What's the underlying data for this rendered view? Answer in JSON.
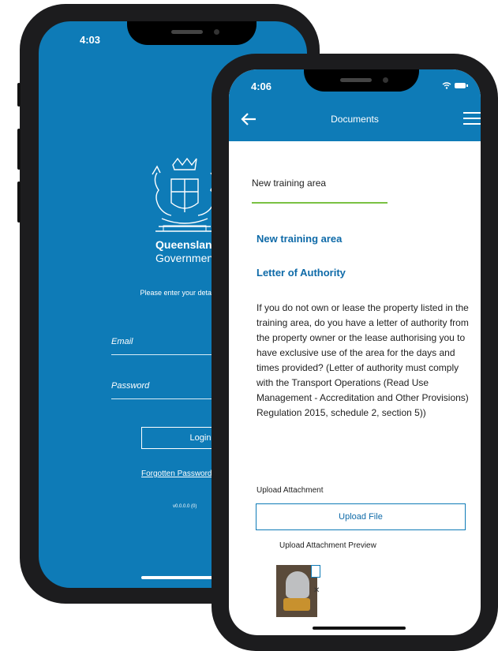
{
  "back_phone": {
    "status_time": "4:03",
    "brand_line1": "Queensland",
    "brand_line2": "Government",
    "login_message": "Please enter your details below to login.",
    "email_label": "Email",
    "password_label": "Password",
    "login_button": "Login",
    "forgot_link": "Forgotten Password?",
    "version": "v0.0.0.0 (0)"
  },
  "front_phone": {
    "status_time": "4:06",
    "header_title": "Documents",
    "breadcrumb": "New training area",
    "section_title": "New training area",
    "section_subtitle": "Letter of Authority",
    "question": "If you do not own or lease the property listed in the training area, do you have a letter of authority from the property owner or the lease authorising you to have exclusive use of the area for the days and times provided? (Letter of authority must comply with the Transport Operations (Read Use Management - Accreditation and Other Provisions) Regulation 2015, schedule 2, section 5))",
    "upload_label": "Upload Attachment",
    "upload_button": "Upload File",
    "preview_label": "Upload Attachment Preview"
  },
  "colors": {
    "brand_blue": "#0e7bb7",
    "heading_blue": "#0e6aa8",
    "accent_green": "#7ac143"
  },
  "icons": [
    "back-arrow-icon",
    "hamburger-menu-icon",
    "wifi-icon",
    "battery-icon",
    "queensland-crest-icon",
    "close-icon"
  ]
}
